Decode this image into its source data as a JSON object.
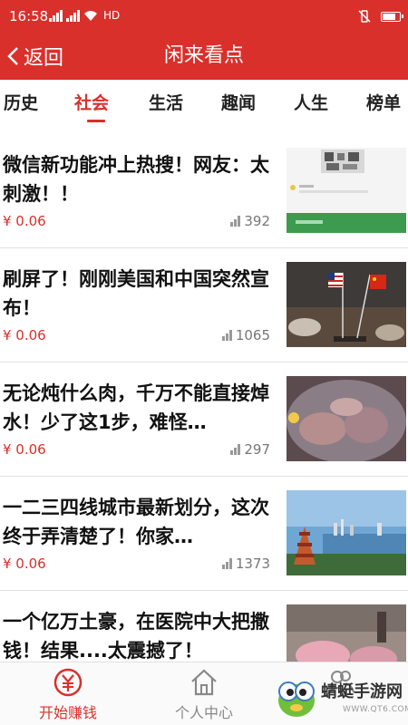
{
  "status_bar": {
    "time": "16:58",
    "network": "HD",
    "battery_level": 0.8
  },
  "header": {
    "back_label": "返回",
    "title": "闲来看点"
  },
  "tabs": [
    {
      "label": "历史",
      "active": false
    },
    {
      "label": "社会",
      "active": true
    },
    {
      "label": "生活",
      "active": false
    },
    {
      "label": "趣闻",
      "active": false
    },
    {
      "label": "人生",
      "active": false
    },
    {
      "label": "榜单",
      "active": false
    }
  ],
  "feed": [
    {
      "title": "微信新功能冲上热搜！网友：太刺激！！",
      "price": "¥ 0.06",
      "views": "392",
      "thumb": "wechat-qr-screenshot"
    },
    {
      "title": "刷屏了！刚刚美国和中国突然宣布！",
      "price": "¥ 0.06",
      "views": "1065",
      "thumb": "us-china-flags"
    },
    {
      "title": "无论炖什么肉，千万不能直接焯水！少了这1步，难怪…",
      "price": "¥ 0.06",
      "views": "297",
      "thumb": "meat-in-pot"
    },
    {
      "title": "一二三四线城市最新划分，这次终于弄清楚了！你家…",
      "price": "¥ 0.06",
      "views": "1373",
      "thumb": "city-skyline-lake"
    },
    {
      "title": "一个亿万土豪，在医院中大把撒钱！结果....太震撼了！",
      "price": "",
      "views": "",
      "thumb": "money-on-floor"
    }
  ],
  "bottom_nav": [
    {
      "label": "开始赚钱",
      "icon": "yuan-coin-icon",
      "active": true
    },
    {
      "label": "个人中心",
      "icon": "home-icon",
      "active": false
    },
    {
      "label": "",
      "icon": "friends-icon",
      "active": false
    }
  ],
  "watermark": {
    "name": "蜻蜓手游网",
    "url": "WWW.QT6.COM"
  },
  "colors": {
    "accent": "#d9302b",
    "text": "#111111",
    "muted": "#777777"
  }
}
